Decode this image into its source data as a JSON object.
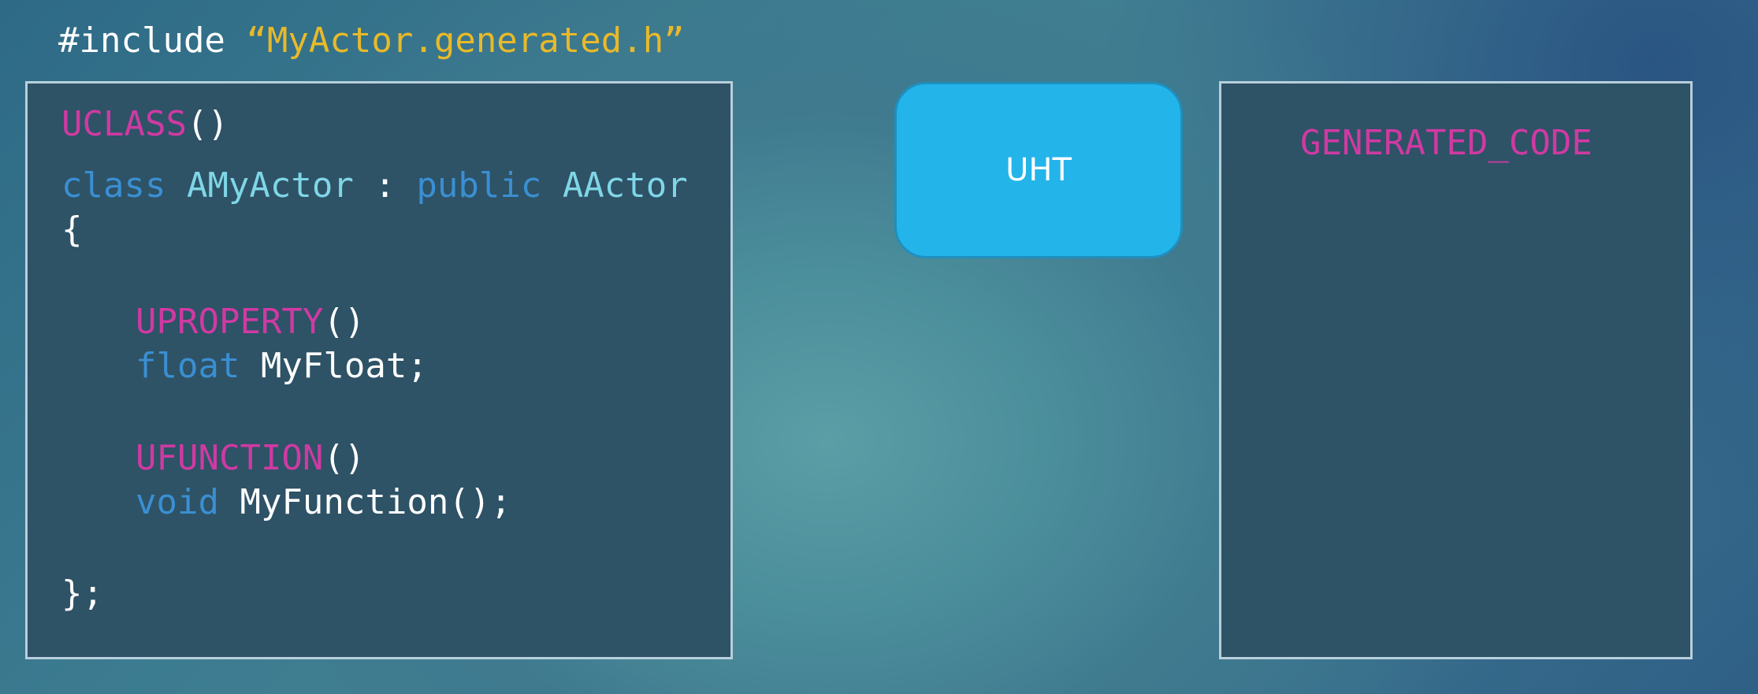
{
  "include": {
    "directive": "#include ",
    "file": "“MyActor.generated.h”"
  },
  "left_panel": {
    "line1": {
      "macro": "UCLASS",
      "parens": "()"
    },
    "line2": {
      "kw_class": "class",
      "class_name": "AMyActor",
      "colon": " : ",
      "kw_public": "public",
      "base_name": "AActor"
    },
    "line3": {
      "text": "{"
    },
    "line4": {
      "macro": "UPROPERTY",
      "parens": "()"
    },
    "line5": {
      "type": "float",
      "rest": " MyFloat;"
    },
    "line6": {
      "macro": "UFUNCTION",
      "parens": "()"
    },
    "line7": {
      "type": "void",
      "rest": " MyFunction();"
    },
    "line8": {
      "text": "};"
    }
  },
  "uht": {
    "label": "UHT"
  },
  "right_panel": {
    "text": "GENERATED_CODE"
  },
  "colors": {
    "macro": "#cf3aa2",
    "keyword": "#3a8fd2",
    "type_name": "#7fd6e6",
    "string": "#e8b92a",
    "uht_fill": "#23b4ea",
    "panel_fill": "#2e5266"
  }
}
